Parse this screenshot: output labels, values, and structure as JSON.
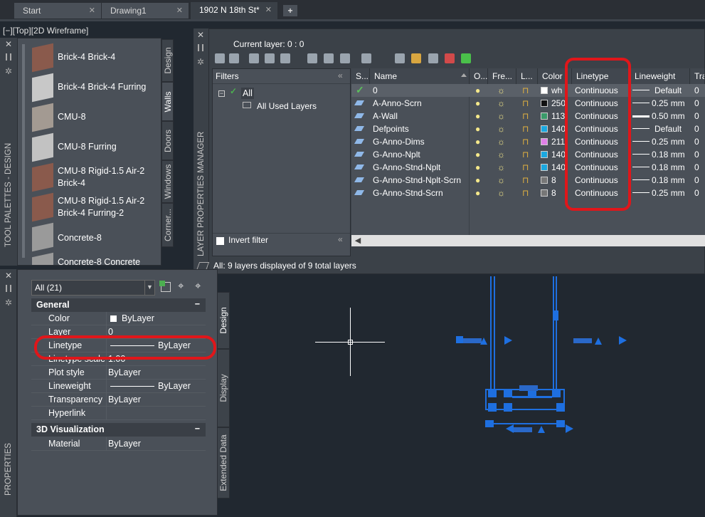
{
  "tabs": [
    {
      "label": "Start"
    },
    {
      "label": "Drawing1"
    },
    {
      "label": "1902 N 18th St*"
    }
  ],
  "new_tab": "+",
  "close_glyph": "✕",
  "viewport_label": "[−][Top][2D Wireframe]",
  "tool_palette": {
    "title": "TOOL PALETTES - DESIGN",
    "items": [
      "Brick-4 Brick-4",
      "Brick-4 Brick-4 Furring",
      "CMU-8",
      "CMU-8 Furring",
      "CMU-8 Rigid-1.5 Air-2 Brick-4",
      "CMU-8 Rigid-1.5 Air-2 Brick-4 Furring-2",
      "Concrete-8",
      "Concrete-8 Concrete"
    ],
    "tabs": [
      "Design",
      "Walls",
      "Doors",
      "Windows",
      "Corner..."
    ]
  },
  "layer_manager": {
    "title": "LAYER PROPERTIES MANAGER",
    "current_layer": "Current layer: 0 : 0",
    "filters_label": "Filters",
    "tree_all": "All",
    "tree_used": "All Used Layers",
    "invert_filter": "Invert filter",
    "status": "All: 9 layers displayed of 9 total layers",
    "columns": [
      "S...",
      "Name",
      "O...",
      "Fre...",
      "L...",
      "Color",
      "Linetype",
      "Lineweight",
      "Tra"
    ],
    "rows": [
      {
        "name": "0",
        "color_text": "wh",
        "color": "#ffffff",
        "linetype": "Continuous",
        "lineweight": "Default",
        "tra": "0"
      },
      {
        "name": "A-Anno-Scrn",
        "color_text": "250",
        "color": "#111111",
        "linetype": "Continuous",
        "lineweight": "0.25 mm",
        "tra": "0"
      },
      {
        "name": "A-Wall",
        "color_text": "113",
        "color": "#3a9a6a",
        "linetype": "Continuous",
        "lineweight": "0.50 mm",
        "tra": "0"
      },
      {
        "name": "Defpoints",
        "color_text": "140",
        "color": "#1ba8e0",
        "linetype": "Continuous",
        "lineweight": "Default",
        "tra": "0"
      },
      {
        "name": "G-Anno-Dims",
        "color_text": "211",
        "color": "#e080e8",
        "linetype": "Continuous",
        "lineweight": "0.25 mm",
        "tra": "0"
      },
      {
        "name": "G-Anno-Nplt",
        "color_text": "140",
        "color": "#1ba8e0",
        "linetype": "Continuous",
        "lineweight": "0.18 mm",
        "tra": "0"
      },
      {
        "name": "G-Anno-Stnd-Nplt",
        "color_text": "140",
        "color": "#1ba8e0",
        "linetype": "Continuous",
        "lineweight": "0.18 mm",
        "tra": "0"
      },
      {
        "name": "G-Anno-Stnd-Nplt-Scrn",
        "color_text": "8",
        "color": "#777777",
        "linetype": "Continuous",
        "lineweight": "0.18 mm",
        "tra": "0"
      },
      {
        "name": "G-Anno-Stnd-Scrn",
        "color_text": "8",
        "color": "#777777",
        "linetype": "Continuous",
        "lineweight": "0.25 mm",
        "tra": "0"
      }
    ]
  },
  "properties": {
    "title": "PROPERTIES",
    "selector": "All (21)",
    "general": "General",
    "rows": [
      {
        "key": "Color",
        "value": "ByLayer"
      },
      {
        "key": "Layer",
        "value": "0"
      },
      {
        "key": "Linetype",
        "value": "ByLayer"
      },
      {
        "key": "Linetype scale",
        "value": "1.00"
      },
      {
        "key": "Plot style",
        "value": "ByLayer"
      },
      {
        "key": "Lineweight",
        "value": "ByLayer"
      },
      {
        "key": "Transparency",
        "value": "ByLayer"
      },
      {
        "key": "Hyperlink",
        "value": ""
      }
    ],
    "viz": "3D Visualization",
    "viz_rows": [
      {
        "key": "Material",
        "value": "ByLayer"
      }
    ],
    "tabs": [
      "Design",
      "Display",
      "Extended Data"
    ]
  },
  "highlight_color": "#e0161a",
  "accent_blue": "#1e6fe0"
}
